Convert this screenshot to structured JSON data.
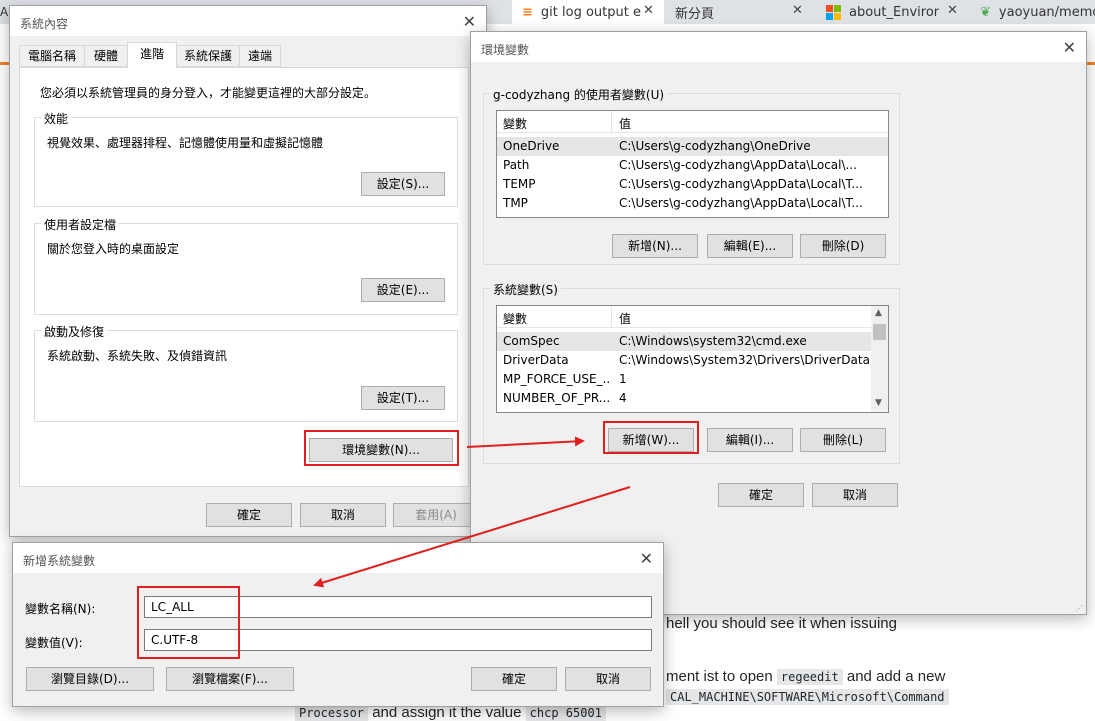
{
  "browser": {
    "tabs": [
      {
        "label": "AP"
      },
      {
        "label": "git log output e"
      },
      {
        "label": "新分頁"
      },
      {
        "label": "about_Environm"
      },
      {
        "label": "yaoyuan/memo"
      }
    ]
  },
  "background_page": {
    "line1": "hell you should see it when issuing",
    "line2_pre": "ment ist to open ",
    "line2_code": "regeedit",
    "line2_post": " and add a new",
    "line3_code": "CAL_MACHINE\\SOFTWARE\\Microsoft\\Command",
    "line4_code1": "Processor",
    "line4_mid": " and assign it the value ",
    "line4_code2": "chcp 65001"
  },
  "sysprops": {
    "title": "系統內容",
    "tabs": [
      "電腦名稱",
      "硬體",
      "進階",
      "系統保護",
      "遠端"
    ],
    "admin_note": "您必須以系統管理員的身分登入，才能變更這裡的大部分設定。",
    "performance": {
      "title": "效能",
      "desc": "視覺效果、處理器排程、記憶體使用量和虛擬記憶體",
      "button": "設定(S)..."
    },
    "profile": {
      "title": "使用者設定檔",
      "desc": "關於您登入時的桌面設定",
      "button": "設定(E)..."
    },
    "startup": {
      "title": "啟動及修復",
      "desc": "系統啟動、系統失敗、及偵錯資訊",
      "button": "設定(T)..."
    },
    "env_button": "環境變數(N)...",
    "ok": "確定",
    "cancel": "取消",
    "apply": "套用(A)"
  },
  "envvars": {
    "title": "環境變數",
    "user_group": "g-codyzhang 的使用者變數(U)",
    "col_var": "變數",
    "col_val": "值",
    "user_vars": [
      {
        "name": "OneDrive",
        "value": "C:\\Users\\g-codyzhang\\OneDrive"
      },
      {
        "name": "Path",
        "value": "C:\\Users\\g-codyzhang\\AppData\\Local\\..."
      },
      {
        "name": "TEMP",
        "value": "C:\\Users\\g-codyzhang\\AppData\\Local\\T..."
      },
      {
        "name": "TMP",
        "value": "C:\\Users\\g-codyzhang\\AppData\\Local\\T..."
      }
    ],
    "user_new": "新增(N)...",
    "user_edit": "編輯(E)...",
    "user_delete": "刪除(D)",
    "sys_group": "系統變數(S)",
    "sys_vars": [
      {
        "name": "ComSpec",
        "value": "C:\\Windows\\system32\\cmd.exe"
      },
      {
        "name": "DriverData",
        "value": "C:\\Windows\\System32\\Drivers\\DriverData"
      },
      {
        "name": "MP_FORCE_USE_...",
        "value": "1"
      },
      {
        "name": "NUMBER_OF_PR...",
        "value": "4"
      }
    ],
    "sys_new": "新增(W)...",
    "sys_edit": "編輯(I)...",
    "sys_delete": "刪除(L)",
    "ok": "確定",
    "cancel": "取消"
  },
  "newvar": {
    "title": "新增系統變數",
    "name_label": "變數名稱(N):",
    "name_value": "LC_ALL",
    "value_label": "變數值(V):",
    "value_value": "C.UTF-8",
    "browse_dir": "瀏覽目錄(D)...",
    "browse_file": "瀏覽檔案(F)...",
    "ok": "確定",
    "cancel": "取消"
  },
  "colors": {
    "highlight": "#e02020",
    "accent_bar": "#f48024"
  }
}
